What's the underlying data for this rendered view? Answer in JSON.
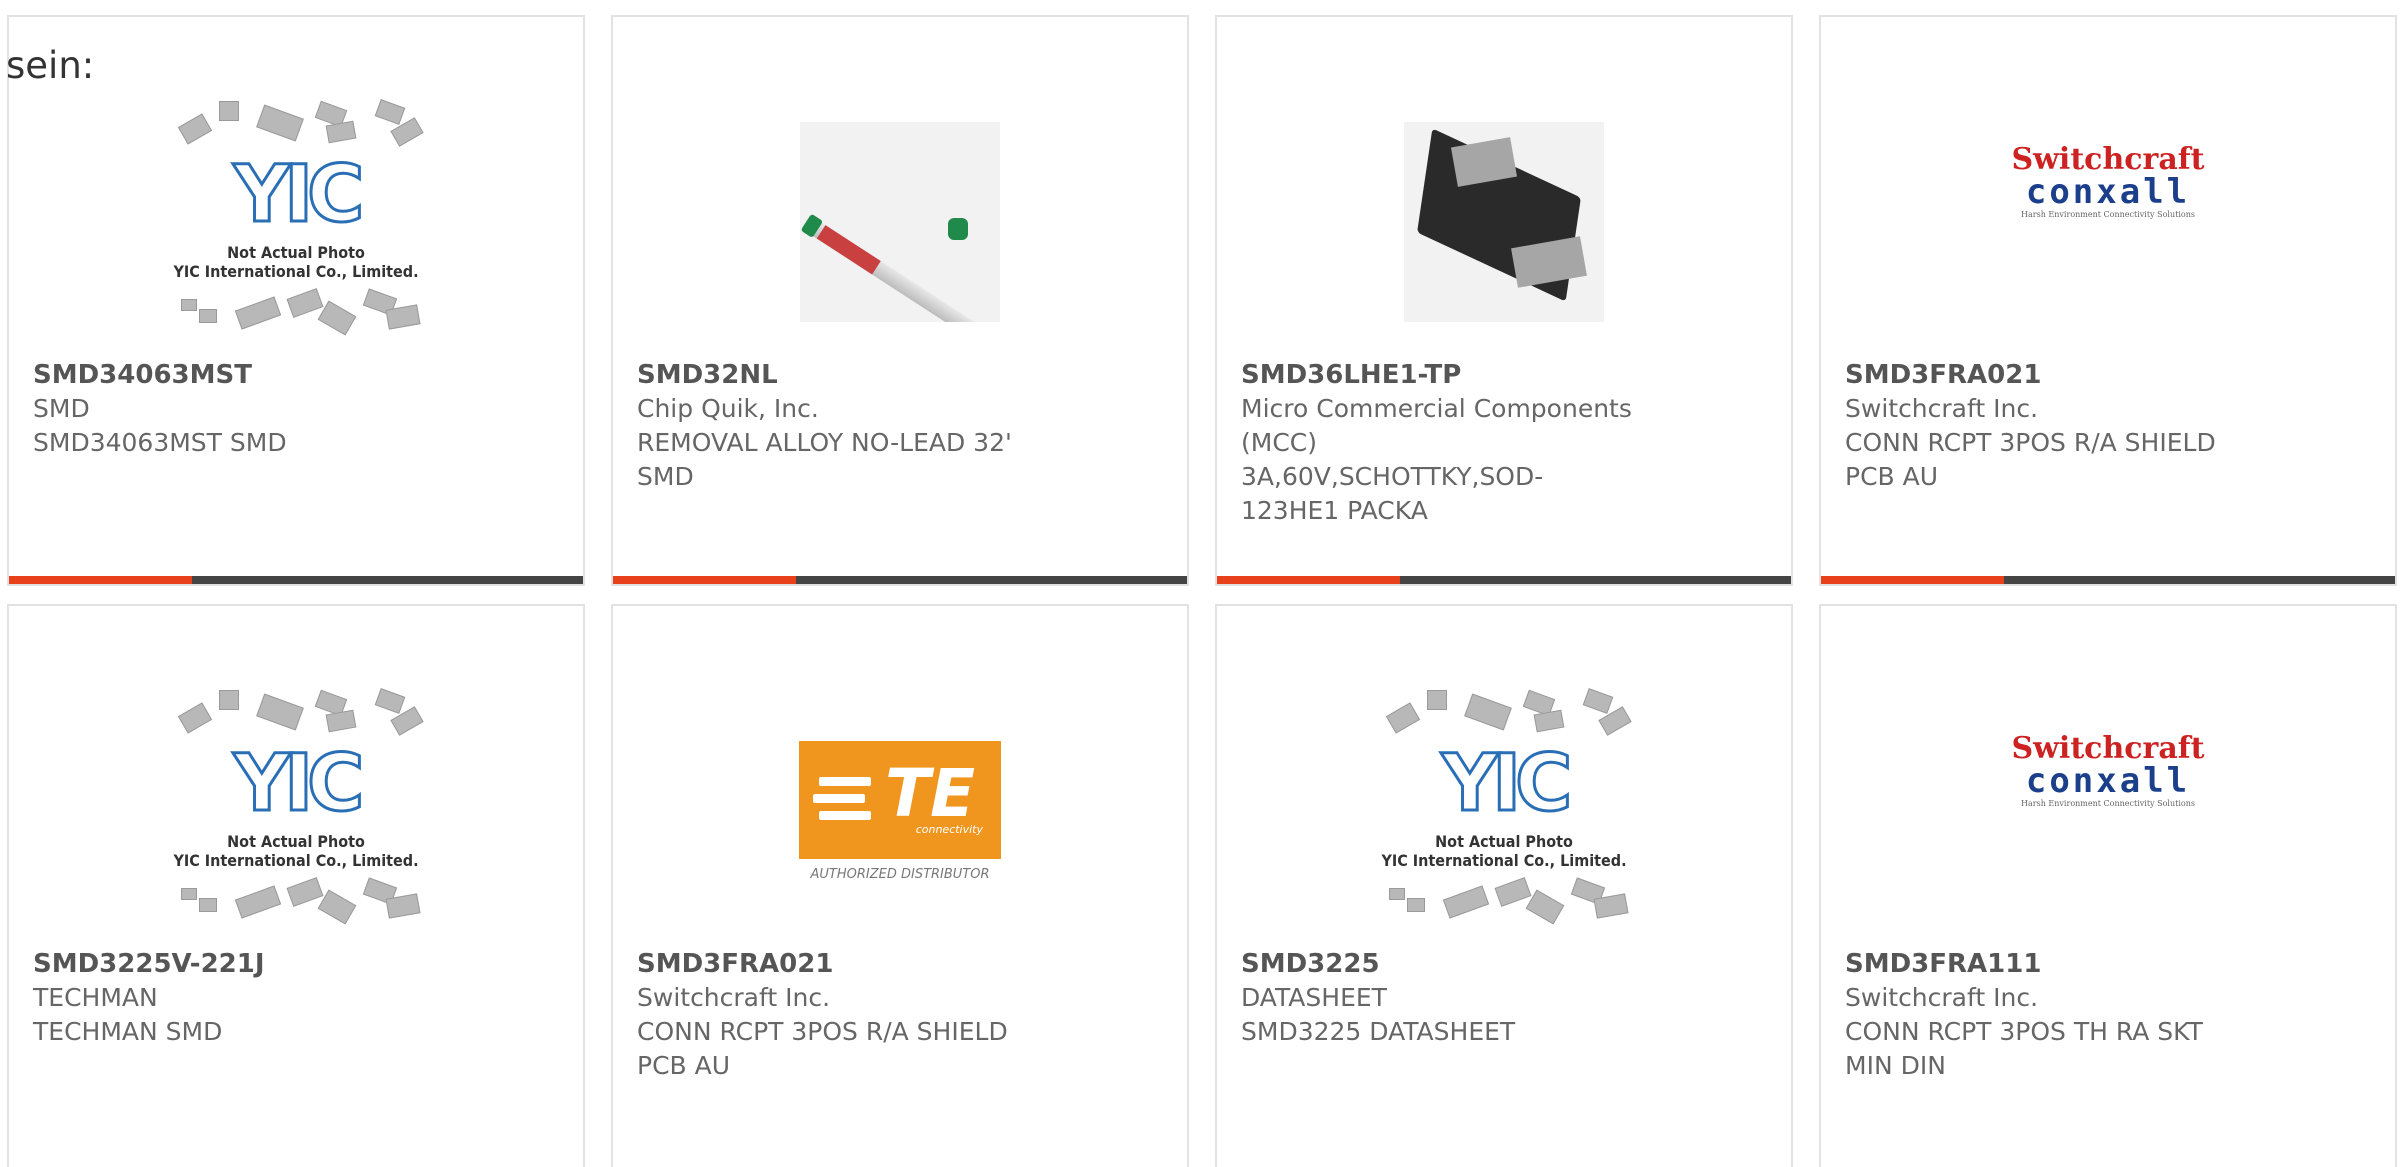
{
  "fragment": "sein:",
  "cards": [
    {
      "part": "SMD34063MST",
      "manufacturer": "SMD",
      "description": "SMD34063MST SMD",
      "image": "yic-placeholder",
      "image_caption": [
        "Not Actual Photo",
        "YIC International Co., Limited."
      ]
    },
    {
      "part": "SMD32NL",
      "manufacturer": "Chip Quik, Inc.",
      "description": "REMOVAL ALLOY NO-LEAD 32' SMD",
      "image": "solder-tube-photo"
    },
    {
      "part": "SMD36LHE1-TP",
      "manufacturer": "Micro Commercial Components (MCC)",
      "description": "3A,60V,SCHOTTKY,SOD-123HE1 PACKA",
      "image": "diode-photo"
    },
    {
      "part": "SMD3FRA021",
      "manufacturer": "Switchcraft Inc.",
      "description": "CONN RCPT 3POS R/A SHIELD PCB AU",
      "image": "switchcraft-logo"
    },
    {
      "part": "SMD3225V-221J",
      "manufacturer": "TECHMAN",
      "description": "TECHMAN SMD",
      "image": "yic-placeholder",
      "image_caption": [
        "Not Actual Photo",
        "YIC International Co., Limited."
      ]
    },
    {
      "part": "SMD3FRA021",
      "manufacturer": "Switchcraft Inc.",
      "description": "CONN RCPT 3POS R/A SHIELD PCB AU",
      "image": "te-logo"
    },
    {
      "part": "SMD3225",
      "manufacturer": "DATASHEET",
      "description": "SMD3225 DATASHEET",
      "image": "yic-placeholder",
      "image_caption": [
        "Not Actual Photo",
        "YIC International Co., Limited."
      ]
    },
    {
      "part": "SMD3FRA111",
      "manufacturer": "Switchcraft Inc.",
      "description": "CONN RCPT 3POS TH RA SKT MIN DIN",
      "image": "switchcraft-logo"
    }
  ],
  "logos": {
    "yic": "YIC",
    "te": {
      "mark": "TE",
      "sub": "connectivity",
      "caption": "AUTHORIZED DISTRIBUTOR"
    },
    "switchcraft": {
      "line1": "Switchcraft",
      "line2": "conxall",
      "line3": "Harsh Environment Connectivity Solutions"
    }
  },
  "colors": {
    "accent": "#e8401a",
    "bar": "#444444",
    "border": "#e2e2e2",
    "te_orange": "#f0961e",
    "yic_blue": "#2a6fb5",
    "switchcraft_red": "#cc2222",
    "conxall_blue": "#1c3f8c"
  }
}
